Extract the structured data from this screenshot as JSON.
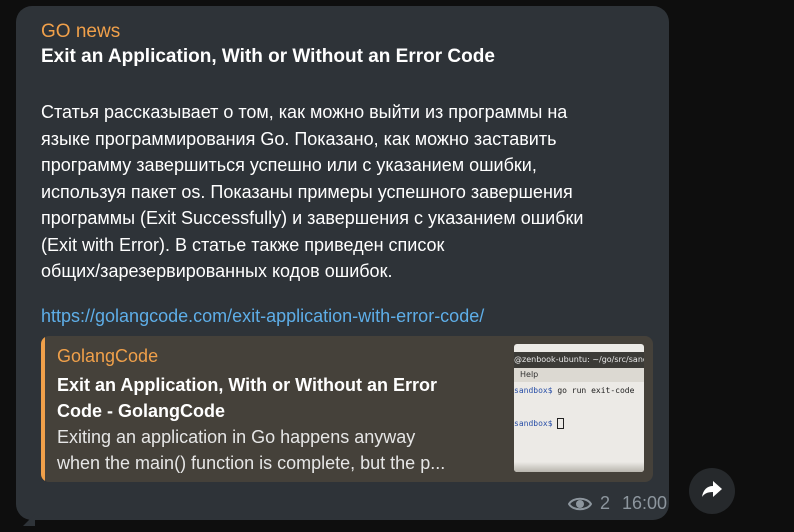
{
  "message": {
    "channel_name": "GO news",
    "headline": "Exit an Application, With or Without an Error Code",
    "body_lines": [
      "Статья рассказывает о том, как можно выйти из программы на",
      "языке программирования Go. Показано, как можно заставить",
      "программу завершиться успешно или с указанием ошибки,",
      "используя пакет os. Показаны примеры успешного завершения",
      "программы (Exit Successfully) и завершения с указанием ошибки",
      "(Exit with Error). В статье также приведен список",
      "общих/зарезервированных кодов ошибок."
    ],
    "link_url": "https://golangcode.com/exit-application-with-error-code/",
    "views": "2",
    "time": "16:00"
  },
  "link_preview": {
    "site_name": "GolangCode",
    "title_lines": [
      "Exit an Application, With or Without an Error",
      "Code - GolangCode"
    ],
    "description_lines": [
      "Exiting an application in Go happens anyway",
      "when the main() function is complete, but the p..."
    ],
    "thumbnail": {
      "titlebar": "@zenbook-ubuntu: ~/go/src/sand",
      "menu": "Help",
      "line1_prompt": "sandbox$",
      "line1_cmd": " go run exit-code",
      "line2_prompt": "sandbox$"
    }
  },
  "colors": {
    "background": "#0e0e0e",
    "bubble": "#2e3338",
    "accent": "#f0a04a",
    "link": "#5eaee8",
    "meta": "#8d969e"
  },
  "icons": {
    "views": "eye-icon",
    "share": "share-arrow-icon"
  }
}
